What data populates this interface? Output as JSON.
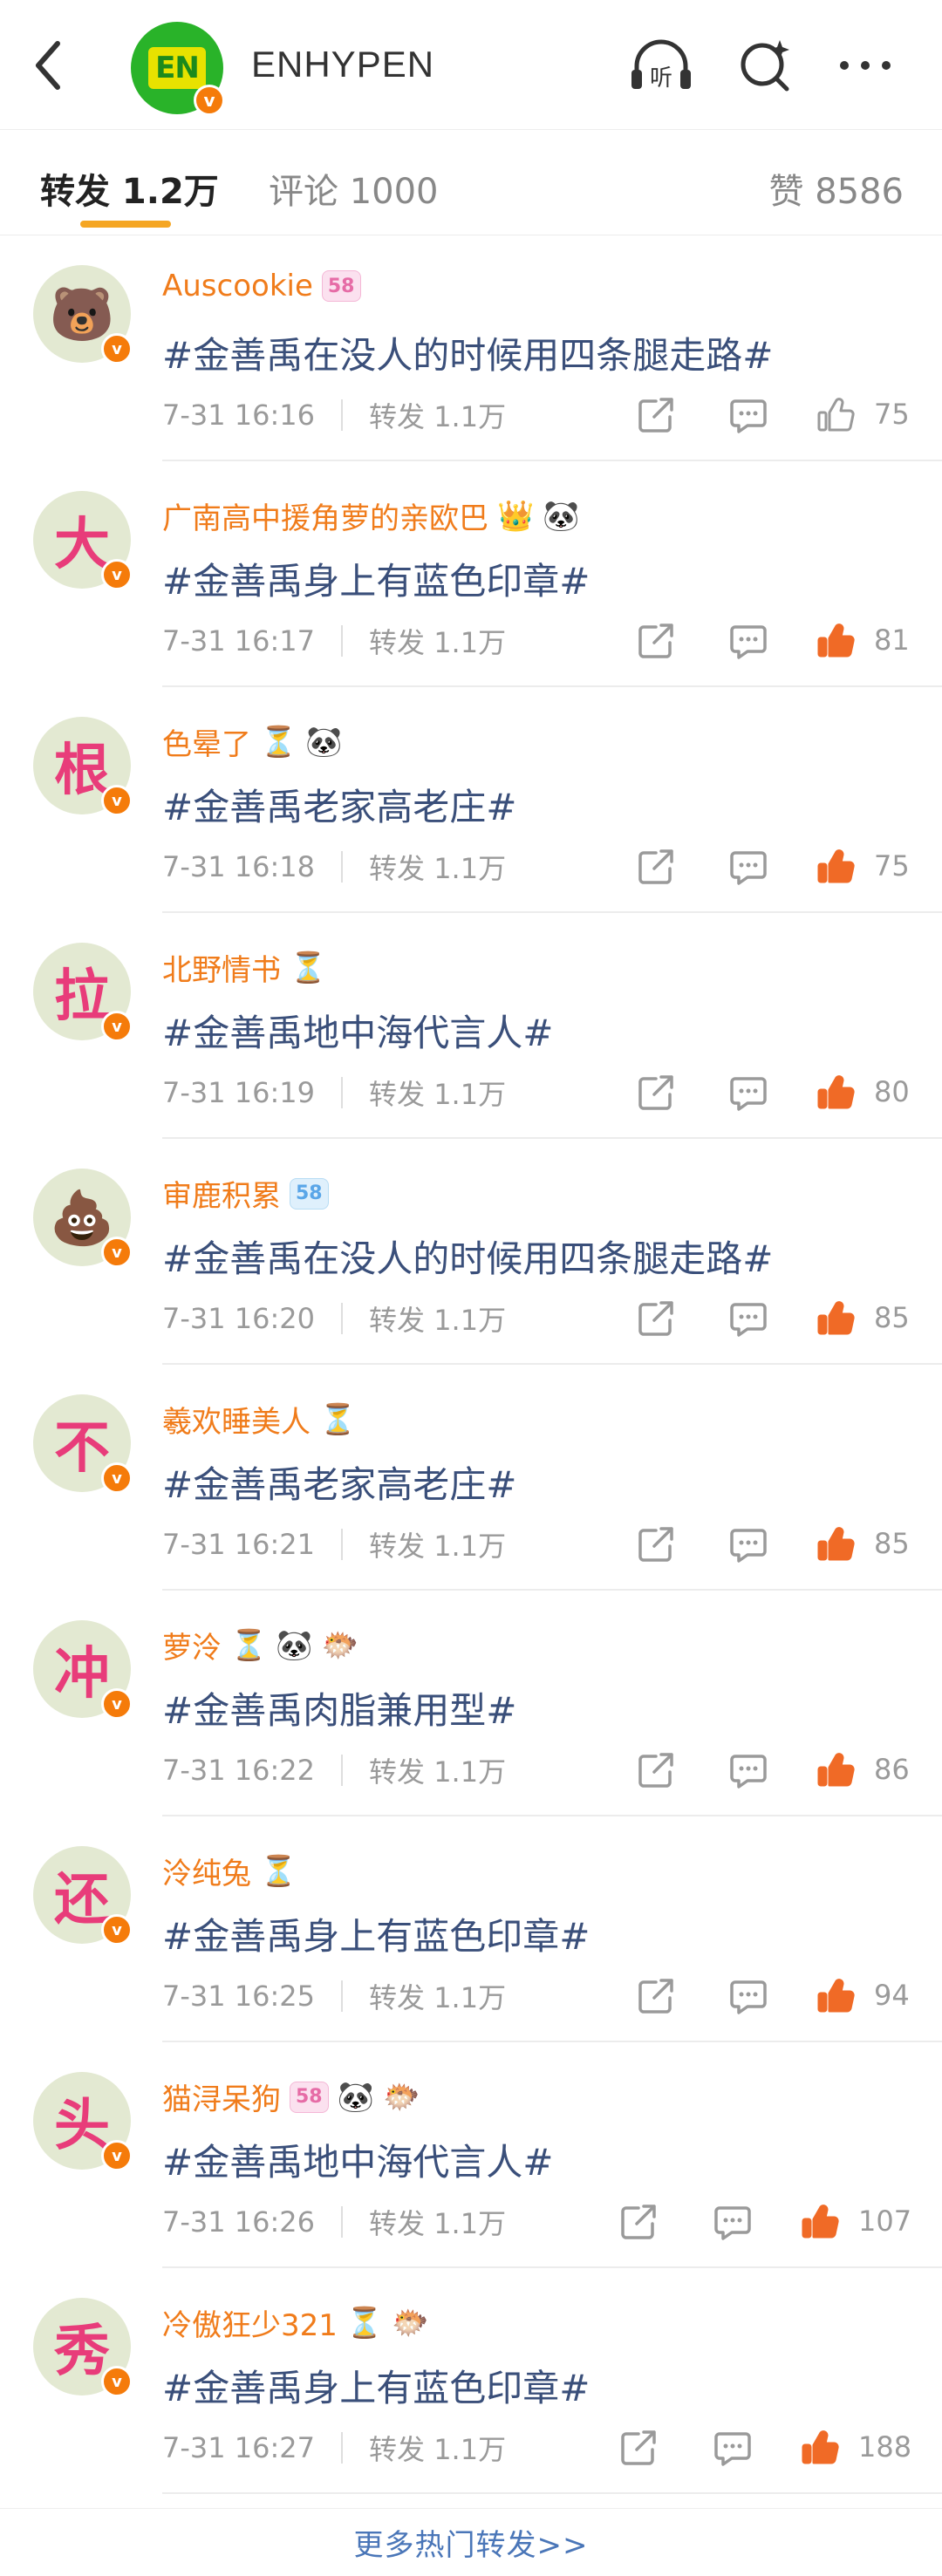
{
  "header": {
    "title": "ENHYPEN",
    "logo_text": "EN",
    "verified_mark": "v"
  },
  "tabs": {
    "repost": "转发 1.2万",
    "comment": "评论 1000",
    "likes": "赞 8586"
  },
  "icons": {
    "back": "back-arrow-icon",
    "listen": "headphone-listen-icon",
    "listen_label": "听",
    "search": "search-sparkle-icon",
    "more": "more-dots-icon"
  },
  "colors": {
    "name": "#f07c1b",
    "topic": "#3a4f7a",
    "verified": "#f57b0a",
    "like_active": "#f06a26",
    "tab_underline": "#f5a623",
    "link": "#4a76b8"
  },
  "reposts": [
    {
      "avatar_char": "",
      "avatar_emoji": "🐻",
      "name": "Auscookie",
      "badges": [
        {
          "type": "pink",
          "text": "58"
        }
      ],
      "emojis": [],
      "text": "#金善禹在没人的时候用四条腿走路#",
      "time": "7-31 16:16",
      "reposts": "转发 1.1万",
      "likes": "75",
      "liked": false
    },
    {
      "avatar_char": "大",
      "avatar_emoji": "",
      "name": "广南高中援角萝的亲欧巴",
      "badges": [],
      "emojis": [
        "👑",
        "🐼"
      ],
      "text": "#金善禹身上有蓝色印章#",
      "time": "7-31 16:17",
      "reposts": "转发 1.1万",
      "likes": "81",
      "liked": true
    },
    {
      "avatar_char": "根",
      "avatar_emoji": "",
      "name": "色晕了",
      "badges": [],
      "emojis": [
        "⏳",
        "🐼"
      ],
      "text": "#金善禹老家高老庄#",
      "time": "7-31 16:18",
      "reposts": "转发 1.1万",
      "likes": "75",
      "liked": true
    },
    {
      "avatar_char": "拉",
      "avatar_emoji": "",
      "name": "北野情书",
      "badges": [],
      "emojis": [
        "⏳"
      ],
      "text": "#金善禹地中海代言人#",
      "time": "7-31 16:19",
      "reposts": "转发 1.1万",
      "likes": "80",
      "liked": true
    },
    {
      "avatar_char": "",
      "avatar_emoji": "💩",
      "name": "审鹿积累",
      "badges": [
        {
          "type": "blue",
          "text": "58"
        }
      ],
      "emojis": [],
      "text": "#金善禹在没人的时候用四条腿走路#",
      "time": "7-31 16:20",
      "reposts": "转发 1.1万",
      "likes": "85",
      "liked": true
    },
    {
      "avatar_char": "不",
      "avatar_emoji": "",
      "name": "羲欢睡美人",
      "badges": [],
      "emojis": [
        "⏳"
      ],
      "text": "#金善禹老家高老庄#",
      "time": "7-31 16:21",
      "reposts": "转发 1.1万",
      "likes": "85",
      "liked": true
    },
    {
      "avatar_char": "冲",
      "avatar_emoji": "",
      "name": "萝泠",
      "badges": [],
      "emojis": [
        "⏳",
        "🐼",
        "🐡"
      ],
      "text": "#金善禹肉脂兼用型#",
      "time": "7-31 16:22",
      "reposts": "转发 1.1万",
      "likes": "86",
      "liked": true
    },
    {
      "avatar_char": "还",
      "avatar_emoji": "",
      "name": "泠纯兔",
      "badges": [],
      "emojis": [
        "⏳"
      ],
      "text": "#金善禹身上有蓝色印章#",
      "time": "7-31 16:25",
      "reposts": "转发 1.1万",
      "likes": "94",
      "liked": true
    },
    {
      "avatar_char": "头",
      "avatar_emoji": "",
      "name": "猫浔呆狗",
      "badges": [
        {
          "type": "pink",
          "text": "58"
        }
      ],
      "emojis": [
        "🐼",
        "🐡"
      ],
      "text": "#金善禹地中海代言人#",
      "time": "7-31 16:26",
      "reposts": "转发 1.1万",
      "likes": "107",
      "liked": true
    },
    {
      "avatar_char": "秀",
      "avatar_emoji": "",
      "name": "冷傲狂少321",
      "badges": [],
      "emojis": [
        "⏳",
        "🐡"
      ],
      "text": "#金善禹身上有蓝色印章#",
      "time": "7-31 16:27",
      "reposts": "转发 1.1万",
      "likes": "188",
      "liked": true
    }
  ],
  "footer": {
    "more_label": "更多热门转发>>"
  }
}
